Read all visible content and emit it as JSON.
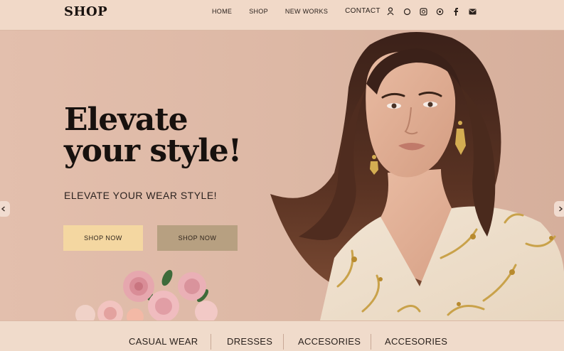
{
  "header": {
    "logo": "SHOP",
    "nav": [
      "HOME",
      "SHOP",
      "NEW WORKS",
      "CONTACT"
    ],
    "icons": [
      "user-icon",
      "search-icon",
      "pinterest-icon",
      "instagram-icon",
      "facebook-icon",
      "mail-icon"
    ]
  },
  "hero": {
    "headline_line1": "Elevate",
    "headline_line2": "your style!",
    "subline": "ELEVATE YOUR WEAR STYLE!",
    "primary_button": "SHOP NOW",
    "secondary_button": "SHOP NOW"
  },
  "categories": [
    "CASUAL WEAR",
    "DRESSES",
    "ACCESORIES",
    "ACCESORIES"
  ],
  "colors": {
    "background": "#e3bfad",
    "header": "#f1d9c8",
    "primary_button": "#f4d7a1",
    "secondary_button": "#b7a081"
  }
}
